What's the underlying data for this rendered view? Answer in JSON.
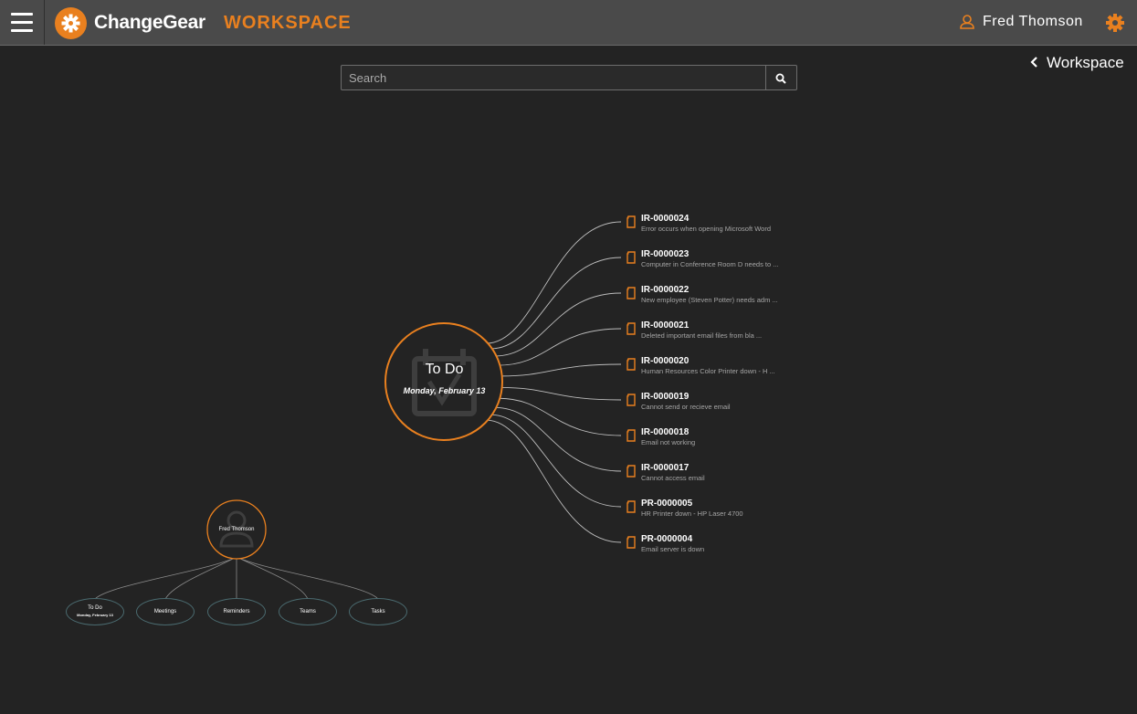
{
  "header": {
    "brand": "ChangeGear",
    "section_title": "WORKSPACE",
    "user_name": "Fred Thomson"
  },
  "search": {
    "placeholder": "Search"
  },
  "breadcrumb": {
    "back_label": "Workspace"
  },
  "hub": {
    "title": "To Do",
    "date": "Monday, February 13"
  },
  "items": [
    {
      "id": "IR-0000024",
      "description": "Error occurs when opening Microsoft Word"
    },
    {
      "id": "IR-0000023",
      "description": "Computer in Conference Room D needs to ..."
    },
    {
      "id": "IR-0000022",
      "description": "New employee (Steven Potter) needs adm ..."
    },
    {
      "id": "IR-0000021",
      "description": "Deleted important email files from bla ..."
    },
    {
      "id": "IR-0000020",
      "description": "Human Resources Color Printer down - H ..."
    },
    {
      "id": "IR-0000019",
      "description": "Cannot send or recieve email"
    },
    {
      "id": "IR-0000018",
      "description": "Email not working"
    },
    {
      "id": "IR-0000017",
      "description": "Cannot access email"
    },
    {
      "id": "PR-0000005",
      "description": "HR Printer down - HP Laser 4700"
    },
    {
      "id": "PR-0000004",
      "description": "Email server is down"
    }
  ],
  "minimap": {
    "user_name": "Fred Thomson",
    "nodes": [
      {
        "label": "To Do",
        "sub": "Monday, February 13"
      },
      {
        "label": "Meetings"
      },
      {
        "label": "Reminders"
      },
      {
        "label": "Teams"
      },
      {
        "label": "Tasks"
      }
    ]
  },
  "colors": {
    "accent": "#e9801f",
    "background": "#232323",
    "topbar": "#4a4a4a"
  }
}
